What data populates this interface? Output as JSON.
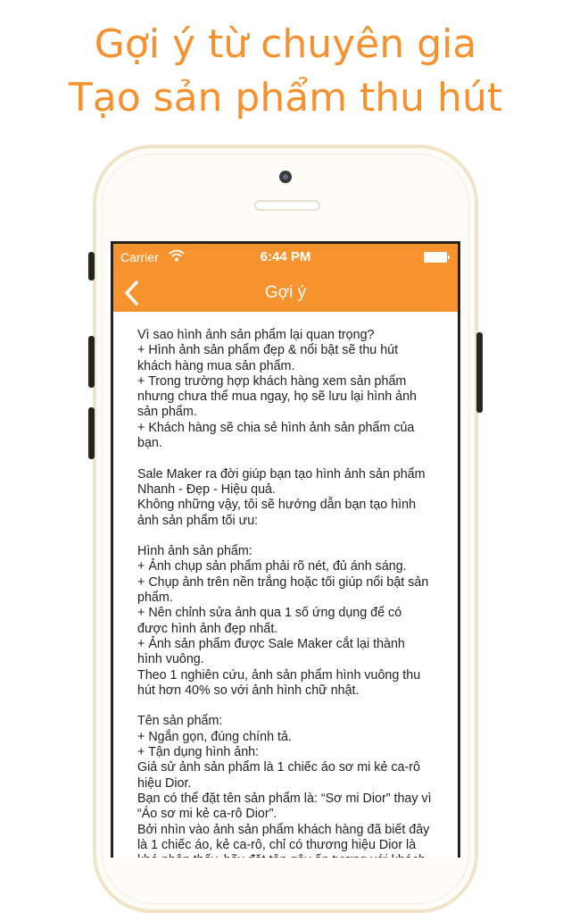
{
  "promo": {
    "line1": "Gợi ý từ chuyên gia",
    "line2": "Tạo sản phẩm thu hút"
  },
  "colors": {
    "accent": "#f7932f",
    "headline": "#f7912d",
    "phone_frame": "#f0e3c6"
  },
  "status_bar": {
    "carrier": "Carrier",
    "wifi_icon": "wifi-icon",
    "time": "6:44 PM",
    "battery_icon": "battery-icon"
  },
  "nav": {
    "back_icon": "chevron-left-icon",
    "title": "Gợi ý"
  },
  "content": {
    "lines": [
      "Vì sao hình ảnh sản phẩm lại quan trọng?",
      "+ Hình ảnh sản phẩm đẹp & nổi bật sẽ thu hút",
      "khách hàng mua sản phẩm.",
      "+ Trong trường hợp khách hàng xem sản phẩm",
      "nhưng chưa thể mua ngay, họ sẽ lưu lại hình ảnh",
      "sản phẩm.",
      "+ Khách hàng sẽ chia sẻ hình ảnh sản phẩm của",
      "bạn.",
      "",
      "Sale Maker ra đời giúp bạn tạo hình ảnh sản phẩm",
      "Nhanh - Đẹp - Hiệu quả.",
      "Không những vậy, tôi sẽ hướng dẫn bạn tạo hình",
      "ảnh sản phẩm tối ưu:",
      "",
      "Hình ảnh sản phẩm:",
      "+ Ảnh chụp sản phẩm phải rõ nét, đủ ánh sáng.",
      "+ Chụp ảnh trên nền trắng hoặc tối giúp nổi bật sản",
      "phẩm.",
      "+ Nên chỉnh sửa ảnh qua 1 số ứng dụng để có",
      "được hình ảnh đẹp nhất.",
      "+ Ảnh sản phẩm được Sale Maker cắt lại thành",
      "hình vuông.",
      "Theo 1 nghiên cứu, ảnh sản phẩm hình vuông thu",
      "hút hơn 40% so với ảnh hình chữ nhật.",
      "",
      "Tên sản phẩm:",
      "+ Ngắn gọn, đúng chính tả.",
      "+ Tận dụng hình ảnh:",
      "Giả sử ảnh sản phẩm là 1 chiếc áo sơ mi kẻ ca-rô",
      "hiệu Dior.",
      "Bạn có thể đặt tên sản phẩm là: “Sơ mi Dior” thay vì",
      "“Áo sơ mi kẻ ca-rô Dior”.",
      "Bởi nhìn vào ảnh sản phẩm khách hàng đã biết đây",
      "là 1 chiếc áo, kẻ ca-rô, chỉ có thương hiệu Dior là",
      "khó nhận thấy, hãy đặt tên gây ấn tượng với khách"
    ]
  }
}
